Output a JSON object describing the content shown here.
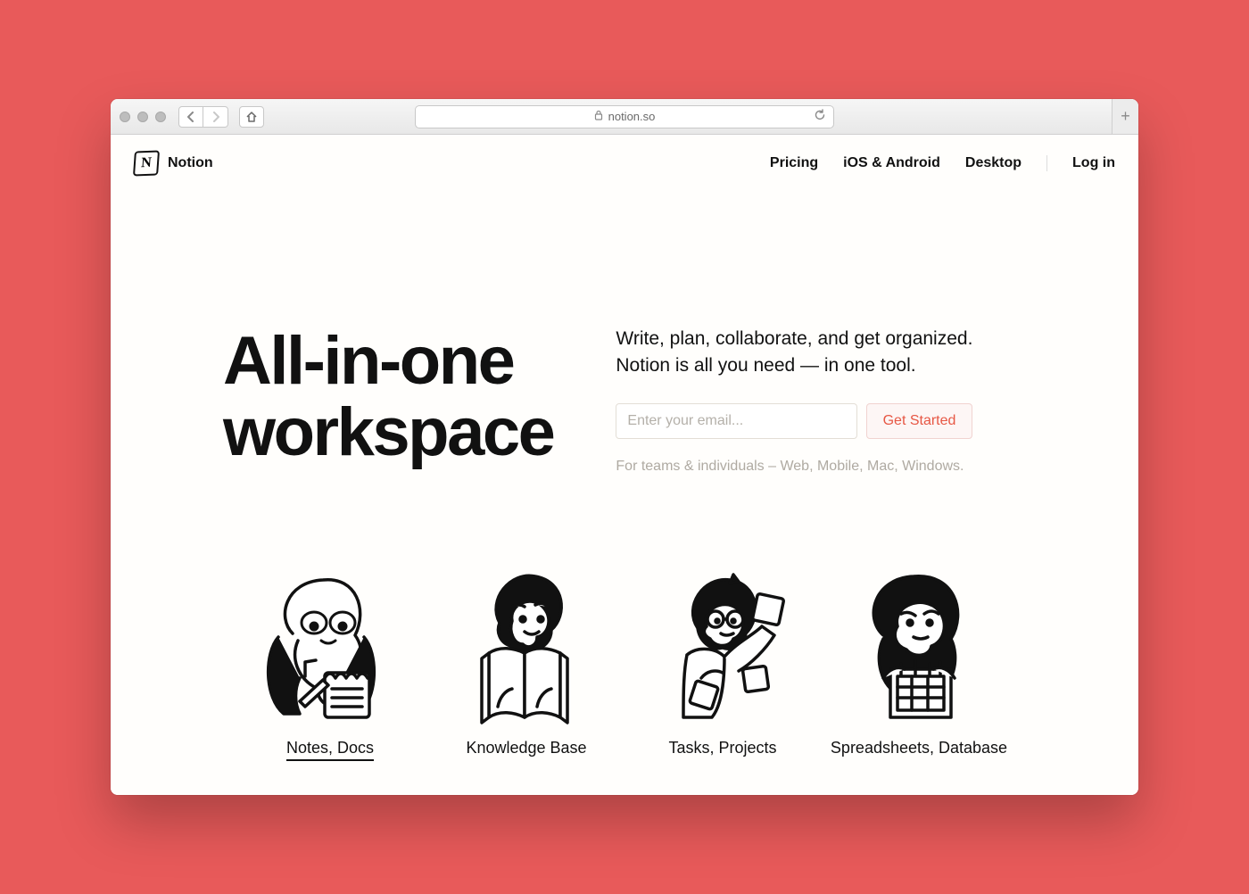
{
  "browser": {
    "url": "notion.so"
  },
  "brand": {
    "name": "Notion",
    "logo_letter": "N"
  },
  "nav": {
    "items": [
      "Pricing",
      "iOS & Android",
      "Desktop"
    ],
    "login": "Log in"
  },
  "hero": {
    "headline_line1": "All-in-one",
    "headline_line2": "workspace",
    "subhead_line1": "Write, plan, collaborate, and get organized.",
    "subhead_line2": "Notion is all you need — in one tool.",
    "email_placeholder": "Enter your email...",
    "cta": "Get Started",
    "fineprint": "For teams & individuals – Web, Mobile, Mac, Windows."
  },
  "features": [
    {
      "label": "Notes, Docs",
      "active": true
    },
    {
      "label": "Knowledge Base",
      "active": false
    },
    {
      "label": "Tasks, Projects",
      "active": false
    },
    {
      "label": "Spreadsheets, Database",
      "active": false
    }
  ],
  "colors": {
    "background": "#e85a5a",
    "page": "#fffefc",
    "accent": "#e75744"
  }
}
